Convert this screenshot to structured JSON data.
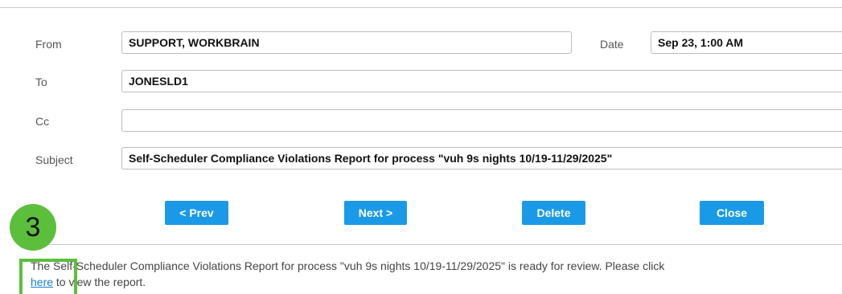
{
  "form": {
    "from_label": "From",
    "from_value": "SUPPORT, WORKBRAIN",
    "date_label": "Date",
    "date_value": "Sep 23, 1:00 AM",
    "to_label": "To",
    "to_value": "JONESLD1",
    "cc_label": "Cc",
    "cc_value": "",
    "subject_label": "Subject",
    "subject_value": "Self-Scheduler Compliance Violations Report for process \"vuh 9s nights 10/19-11/29/2025\""
  },
  "actions": {
    "prev": "< Prev",
    "next": "Next >",
    "delete": "Delete",
    "close": "Close"
  },
  "message": {
    "line1": "The Self-Scheduler Compliance Violations Report for process \"vuh 9s nights 10/19-11/29/2025\" is ready for review. Please click",
    "link": "here",
    "line2_rest": " to view the report."
  },
  "callout": {
    "step_number": "3",
    "color": "#5cbf3b"
  },
  "colors": {
    "button_bg": "#1a9ae6",
    "link": "#1a7dd6"
  }
}
